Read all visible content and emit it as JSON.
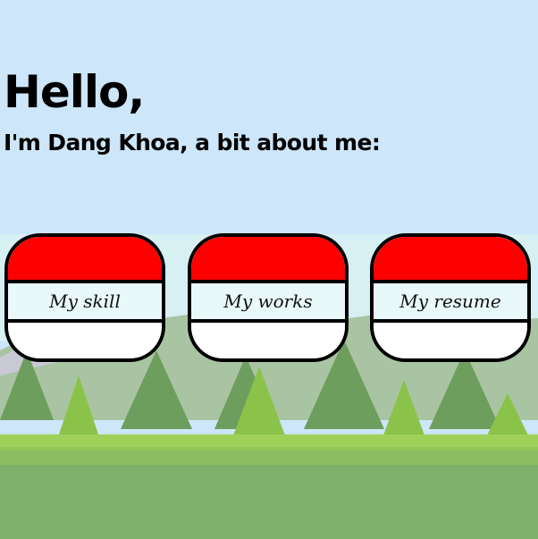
{
  "header": {
    "title": "Hello,",
    "subtitle": "I'm Dang Khoa, a bit about me:"
  },
  "menu": {
    "items": [
      {
        "label": "My skill"
      },
      {
        "label": "My works"
      },
      {
        "label": "My resume"
      }
    ]
  },
  "colors": {
    "sky": "#cde6f9",
    "mountain": "#a9c4a3",
    "tree_dark": "#6e9e5d",
    "tree_light": "#8bc24a",
    "grass": "#7fb06c",
    "ball_red": "#ff0000"
  }
}
